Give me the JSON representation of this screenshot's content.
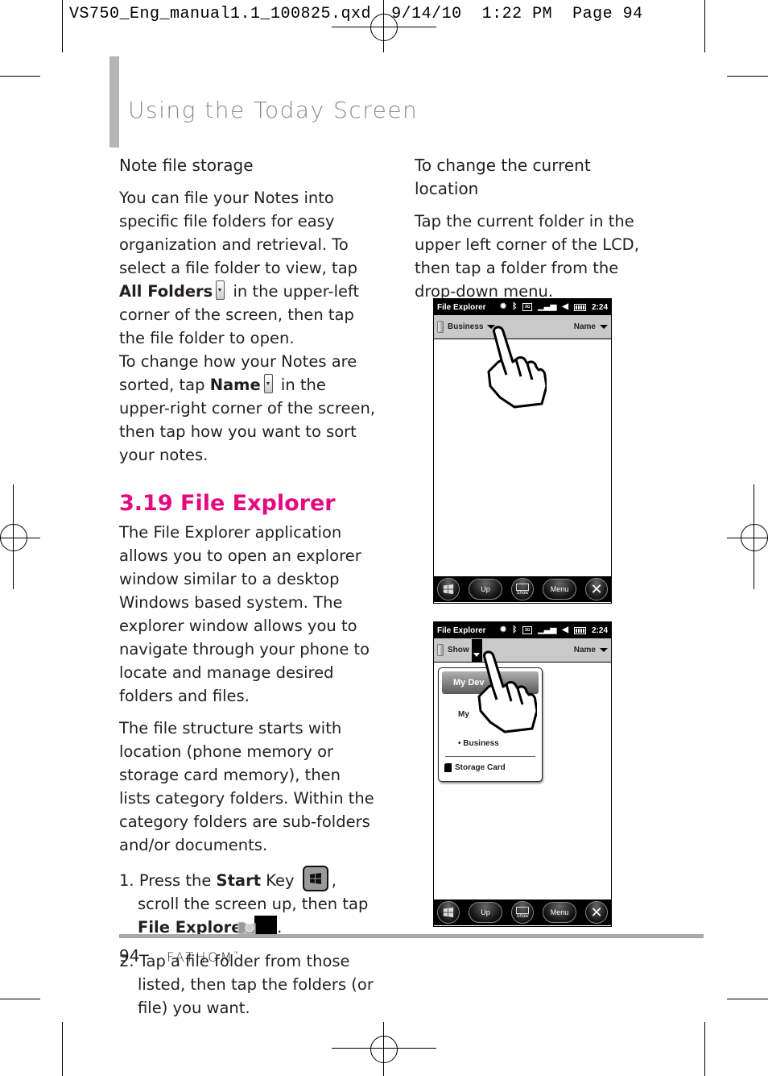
{
  "slug": "VS750_Eng_manual1.1_100825.qxd  9/14/10  1:22 PM  Page 94",
  "header": {
    "title": "Using the Today Screen"
  },
  "left_column": {
    "note_storage": {
      "heading": "Note file storage",
      "p1_a": "You can file your Notes into specific file folders for easy organization and retrieval. To select a file folder to view, tap ",
      "p1_bold": "All Folders",
      "p1_b": " in the upper-left corner of the screen, then tap the file folder to open.",
      "p2_a": "To change how your Notes are sorted, tap ",
      "p2_bold": "Name",
      "p2_b": " in the upper-right corner of the screen, then tap how you want to sort your notes."
    },
    "section": {
      "title": "3.19 File Explorer",
      "p1": "The File Explorer application allows you to open an explorer window similar to a desktop Windows based system. The explorer window allows you to navigate through your phone to locate and manage desired folders and files.",
      "p2": "The file structure starts with location (phone memory or storage card memory), then lists category folders. Within the category folders are sub-folders and/or documents."
    },
    "steps": [
      {
        "num": "1.",
        "a": "Press the ",
        "bold1": "Start",
        "b": " Key ",
        "c": ", scroll the screen up, then tap ",
        "bold2": "File Explorer",
        "d": "."
      },
      {
        "num": "2.",
        "text": "Tap a file folder from those listed, then tap the folders (or file) you want."
      }
    ],
    "icons": {
      "dropdown": "dropdown-arrow-icon",
      "start_key": "windows-start-key-icon",
      "file_explorer": "file-explorer-icon"
    }
  },
  "right_column": {
    "heading": "To change the current location",
    "body": "Tap the current folder in the upper left corner of the LCD, then tap a folder from the drop-down menu."
  },
  "screens": [
    {
      "app_title": "File Explorer",
      "time": "2:24",
      "network": "3G",
      "folder": "Business",
      "sort": "Name",
      "softkeys": {
        "up": "Up",
        "keyboard": "Show",
        "menu": "Menu"
      }
    },
    {
      "app_title": "File Explorer",
      "time": "2:24",
      "network": "3G",
      "folder": "Show",
      "sort": "Name",
      "dropdown": {
        "header": "My Dev",
        "item1": "My",
        "item2": "• Business",
        "storage": "Storage Card"
      },
      "softkeys": {
        "up": "Up",
        "keyboard": "Show",
        "menu": "Menu"
      }
    }
  ],
  "footer": {
    "page_number": "94",
    "brand": "FATHOM",
    "trademark": "™"
  },
  "colors": {
    "section_title": "#e5097f",
    "header_title": "#8a8a8a",
    "header_bar": "#b5b5b5",
    "footer_rule": "#a8a8a8"
  }
}
